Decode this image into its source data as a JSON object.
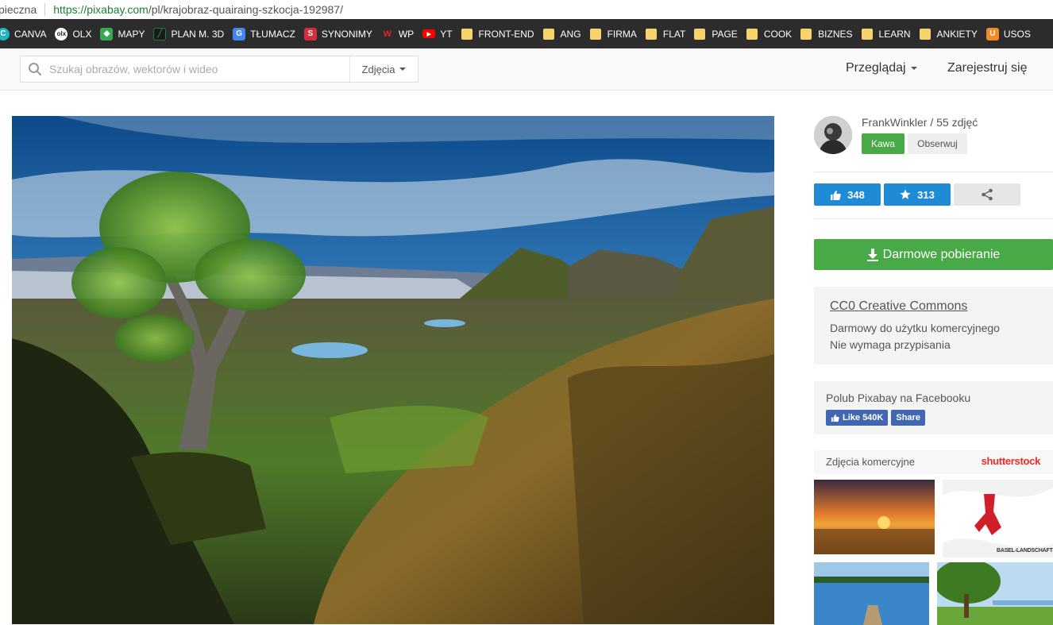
{
  "browser": {
    "security_text": "pieczna",
    "url_host": "https://pixabay.com",
    "url_path": "/pl/krajobraz-quairaing-szkocja-192987/"
  },
  "bookmarks": [
    {
      "label": "CANVA",
      "icon": "canva-icon",
      "color": "#1fb6c3"
    },
    {
      "label": "OLX",
      "icon": "olx-icon",
      "color": "#ffffff"
    },
    {
      "label": "MAPY",
      "icon": "maps-icon",
      "color": "#34a853"
    },
    {
      "label": "PLAN M. 3D",
      "icon": "chart-icon",
      "color": "#1e7e34"
    },
    {
      "label": "TŁUMACZ",
      "icon": "translate-icon",
      "color": "#4285f4"
    },
    {
      "label": "SYNONIMY",
      "icon": "s-icon",
      "color": "#d62d3a"
    },
    {
      "label": "WP",
      "icon": "wp-icon",
      "color": "#e3242b"
    },
    {
      "label": "YT",
      "icon": "youtube-icon",
      "color": "#ff0000"
    },
    {
      "label": "FRONT-END",
      "icon": "folder-icon",
      "color": "#f6d36b"
    },
    {
      "label": "ANG",
      "icon": "folder-icon",
      "color": "#f6d36b"
    },
    {
      "label": "FIRMA",
      "icon": "folder-icon",
      "color": "#f6d36b"
    },
    {
      "label": "FLAT",
      "icon": "folder-icon",
      "color": "#f6d36b"
    },
    {
      "label": "PAGE",
      "icon": "folder-icon",
      "color": "#f6d36b"
    },
    {
      "label": "COOK",
      "icon": "folder-icon",
      "color": "#f6d36b"
    },
    {
      "label": "BIZNES",
      "icon": "folder-icon",
      "color": "#f6d36b"
    },
    {
      "label": "LEARN",
      "icon": "folder-icon",
      "color": "#f6d36b"
    },
    {
      "label": "ANKIETY",
      "icon": "folder-icon",
      "color": "#f6d36b"
    },
    {
      "label": "USOS",
      "icon": "usos-icon",
      "color": "#f08a24"
    }
  ],
  "header": {
    "search_placeholder": "Szukaj obrazów, wektorów i wideo",
    "search_type": "Zdjęcia",
    "browse": "Przeglądaj",
    "register": "Zarejestruj się"
  },
  "author": {
    "name_line": "FrankWinkler / 55 zdjęć",
    "coffee": "Kawa",
    "follow": "Obserwuj"
  },
  "stats": {
    "likes": "348",
    "favorites": "313"
  },
  "download": "Darmowe pobieranie",
  "license": {
    "title": "CC0 Creative Commons",
    "line1": "Darmowy do użytku komercyjnego",
    "line2": "Nie wymaga przypisania"
  },
  "facebook": {
    "text": "Polub Pixabay na Facebooku",
    "like": "Like 540K",
    "share": "Share"
  },
  "commercial": {
    "label": "Zdjęcia komercyjne",
    "logo": "shutterstock",
    "thumb_caption": "BASEL-LANDSCHAFT"
  },
  "colors": {
    "green": "#48a947",
    "blue": "#1f8ad6",
    "facebook": "#4267b2"
  }
}
